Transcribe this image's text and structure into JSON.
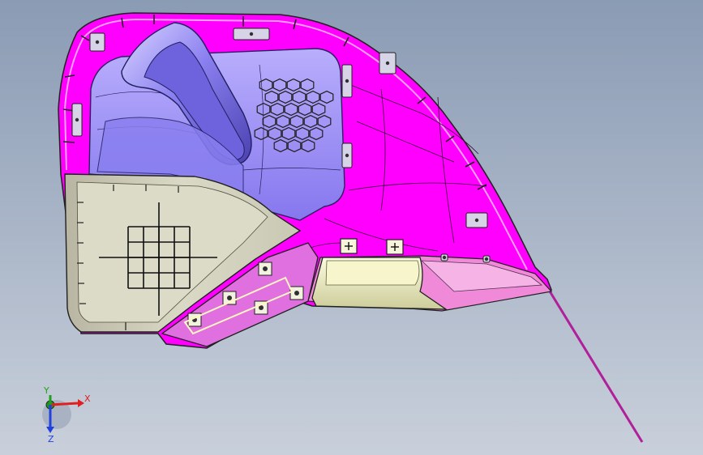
{
  "viewport": {
    "background_top": "#8a9bb4",
    "background_bottom": "#c9d0db"
  },
  "part": {
    "shell_color": "#ff00ff",
    "inner_panel_color": "#9a8cf5",
    "duct_color": "#8b80f0",
    "wall_color": "#d7d6c2",
    "lower_flange_color": "#f08ad8",
    "clip_color": "#f3f2c8",
    "edge_color": "#202020"
  },
  "triad": {
    "x_label": "X",
    "y_label": "Y",
    "z_label": "Z",
    "x_color": "#e02020",
    "y_color": "#20a020",
    "z_color": "#2040e0"
  }
}
